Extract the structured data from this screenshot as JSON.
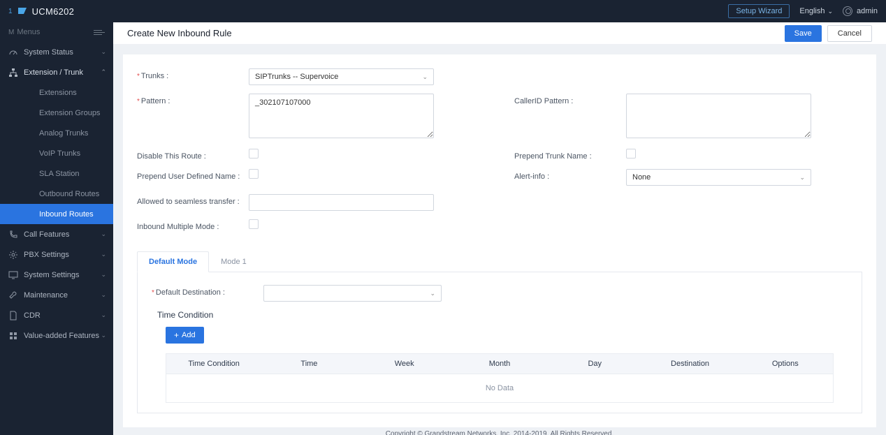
{
  "header": {
    "product": "UCM6202",
    "setup_wizard": "Setup Wizard",
    "language": "English",
    "user": "admin"
  },
  "sidebar": {
    "menus_label": "Menus",
    "items": [
      {
        "label": "System Status"
      },
      {
        "label": "Extension / Trunk",
        "expanded": true
      },
      {
        "label": "Call Features"
      },
      {
        "label": "PBX Settings"
      },
      {
        "label": "System Settings"
      },
      {
        "label": "Maintenance"
      },
      {
        "label": "CDR"
      },
      {
        "label": "Value-added Features"
      }
    ],
    "subs": [
      {
        "label": "Extensions"
      },
      {
        "label": "Extension Groups"
      },
      {
        "label": "Analog Trunks"
      },
      {
        "label": "VoIP Trunks"
      },
      {
        "label": "SLA Station"
      },
      {
        "label": "Outbound Routes"
      },
      {
        "label": "Inbound Routes"
      }
    ]
  },
  "page": {
    "title": "Create New Inbound Rule",
    "save": "Save",
    "cancel": "Cancel"
  },
  "form": {
    "trunks_label": "Trunks :",
    "trunks_value": "SIPTrunks -- Supervoice",
    "pattern_label": "Pattern :",
    "pattern_value": "_302107107000",
    "callerid_label": "CallerID Pattern :",
    "callerid_value": "",
    "disable_route_label": "Disable This Route :",
    "prepend_trunk_label": "Prepend Trunk Name :",
    "prepend_user_label": "Prepend User Defined Name :",
    "alert_info_label": "Alert-info :",
    "alert_info_value": "None",
    "seamless_label": "Allowed to seamless transfer :",
    "multiple_mode_label": "Inbound Multiple Mode :"
  },
  "tabs": {
    "default_mode": "Default Mode",
    "mode1": "Mode 1"
  },
  "dest": {
    "label": "Default Destination :",
    "value": ""
  },
  "tc": {
    "title": "Time Condition",
    "add": "Add",
    "cols": [
      "Time Condition",
      "Time",
      "Week",
      "Month",
      "Day",
      "Destination",
      "Options"
    ],
    "nodata": "No Data"
  },
  "footer": "Copyright © Grandstream Networks, Inc. 2014-2019. All Rights Reserved."
}
